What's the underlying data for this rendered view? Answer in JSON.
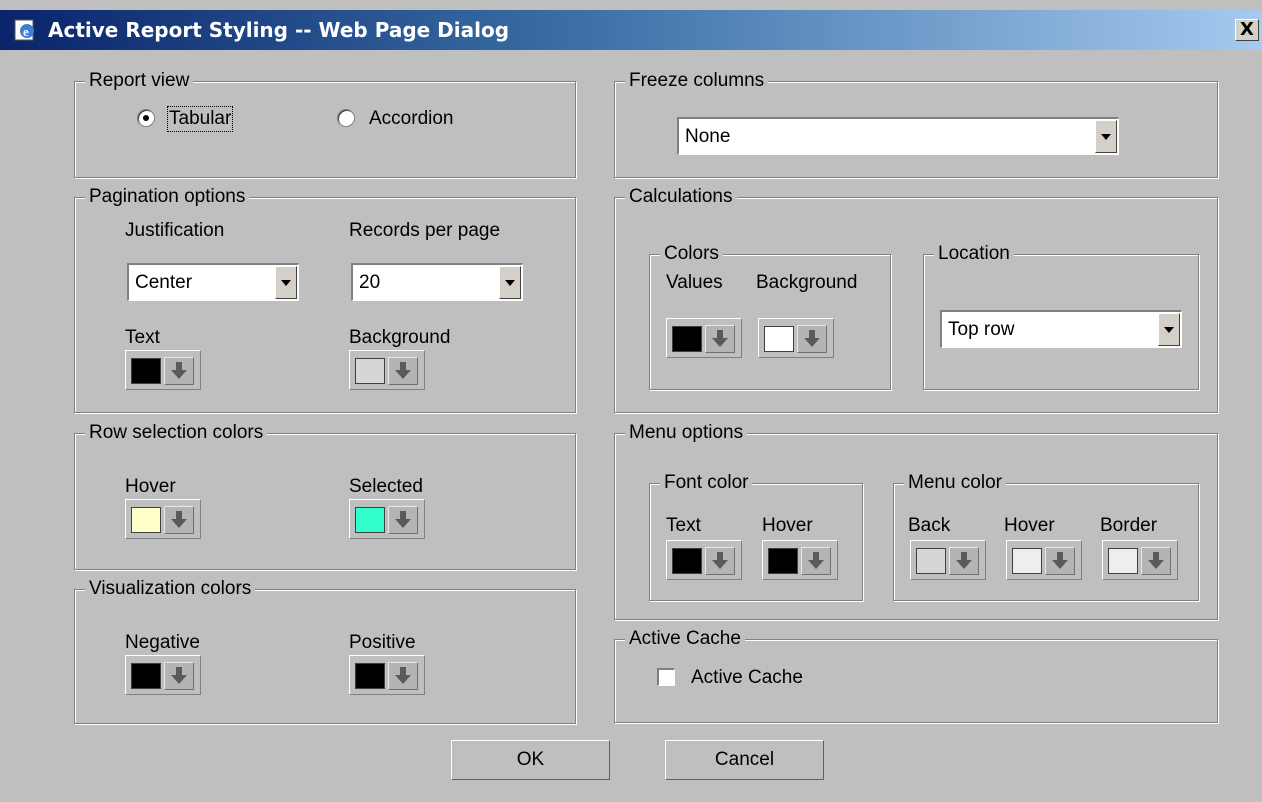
{
  "window": {
    "title": "Active Report Styling -- Web Page Dialog",
    "close_label": "X"
  },
  "report_view": {
    "legend": "Report view",
    "options": [
      {
        "label": "Tabular",
        "selected": true
      },
      {
        "label": "Accordion",
        "selected": false
      }
    ]
  },
  "pagination": {
    "legend": "Pagination options",
    "justification_label": "Justification",
    "justification_value": "Center",
    "records_label": "Records per page",
    "records_value": "20",
    "text_label": "Text",
    "text_color": "#000000",
    "background_label": "Background",
    "background_color": "#d6d6d6"
  },
  "row_selection": {
    "legend": "Row selection colors",
    "hover_label": "Hover",
    "hover_color": "#ffffcc",
    "selected_label": "Selected",
    "selected_color": "#33ffcc"
  },
  "visualization": {
    "legend": "Visualization colors",
    "negative_label": "Negative",
    "negative_color": "#000000",
    "positive_label": "Positive",
    "positive_color": "#000000"
  },
  "freeze": {
    "legend": "Freeze columns",
    "value": "None"
  },
  "calculations": {
    "legend": "Calculations",
    "colors_legend": "Colors",
    "values_label": "Values",
    "values_color": "#000000",
    "background_label": "Background",
    "background_color": "#ffffff",
    "location_legend": "Location",
    "location_value": "Top row"
  },
  "menu_options": {
    "legend": "Menu options",
    "font_color_legend": "Font color",
    "text_label": "Text",
    "text_color": "#000000",
    "hover_label": "Hover",
    "hover_color": "#000000",
    "menu_color_legend": "Menu color",
    "back_label": "Back",
    "back_color": "#d6d6d6",
    "menu_hover_label": "Hover",
    "menu_hover_color": "#eeeeee",
    "border_label": "Border",
    "border_color": "#eeeeee"
  },
  "active_cache": {
    "legend": "Active Cache",
    "checkbox_label": "Active Cache",
    "checked": false
  },
  "buttons": {
    "ok": "OK",
    "cancel": "Cancel"
  }
}
